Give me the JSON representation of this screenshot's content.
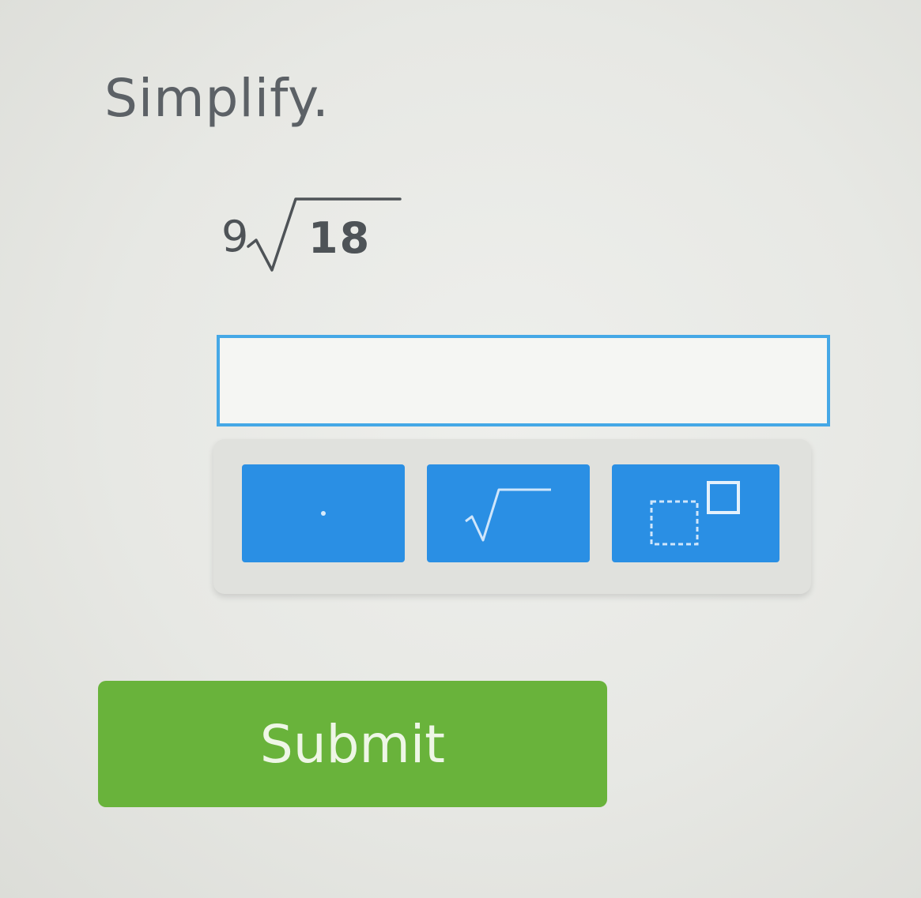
{
  "question": {
    "instruction": "Simplify.",
    "expression": {
      "coefficient": "9",
      "radicand": "18"
    }
  },
  "answer": {
    "value": "",
    "placeholder": ""
  },
  "keypad": {
    "keys": [
      {
        "name": "decimal-point",
        "icon": "dot-icon"
      },
      {
        "name": "square-root",
        "icon": "square-root-icon"
      },
      {
        "name": "exponent",
        "icon": "exponent-icon"
      }
    ]
  },
  "actions": {
    "submit_label": "Submit"
  },
  "colors": {
    "key_blue": "#2a8fe4",
    "submit_green": "#69b33b",
    "input_border": "#45a8e6"
  }
}
